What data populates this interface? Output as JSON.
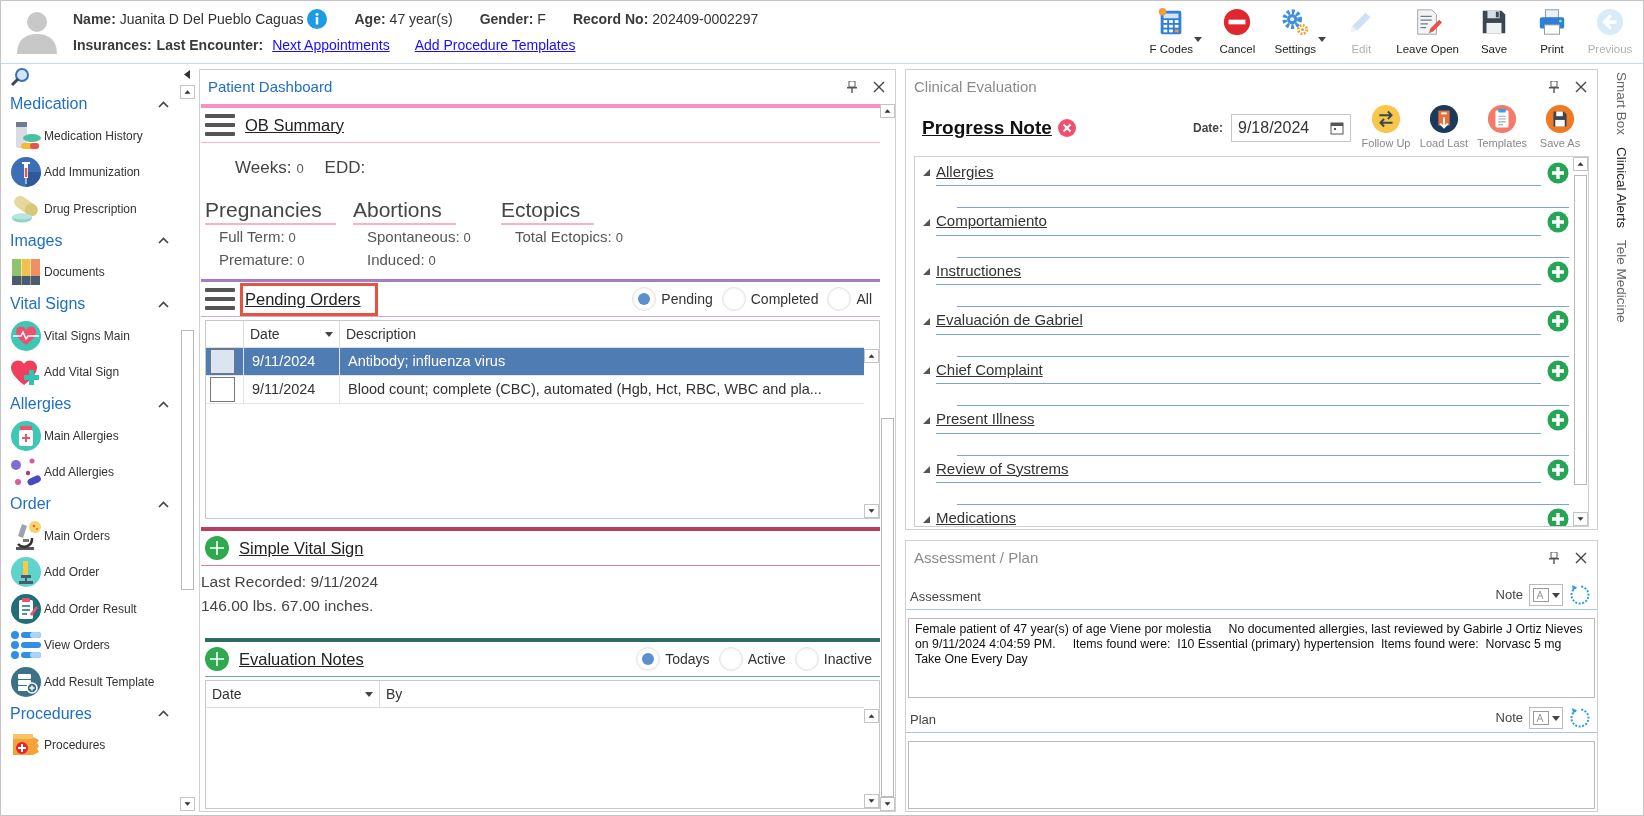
{
  "patient": {
    "fields": [
      {
        "label": "Name:",
        "value": "Juanita D Del Pueblo Caguas",
        "info": true
      },
      {
        "label": "Age:",
        "value": "47 year(s)"
      },
      {
        "label": "Gender:",
        "value": "F"
      },
      {
        "label": "Record No:",
        "value": "202409-0002297"
      }
    ],
    "second_line": {
      "labels": [
        "Insurances:",
        "Last Encounter:"
      ],
      "links": [
        "Next Appointments",
        "Add Procedure Templates"
      ]
    }
  },
  "toolbar": [
    {
      "label": "F Codes",
      "kind": "fcodes",
      "dropdown": true,
      "disabled": false
    },
    {
      "label": "Cancel",
      "kind": "cancel",
      "dropdown": false,
      "disabled": false
    },
    {
      "label": "Settings",
      "kind": "settings",
      "dropdown": true,
      "disabled": false
    },
    {
      "label": "Edit",
      "kind": "edit",
      "dropdown": false,
      "disabled": true
    },
    {
      "label": "Leave Open",
      "kind": "leave_open",
      "dropdown": false,
      "disabled": false
    },
    {
      "label": "Save",
      "kind": "save",
      "dropdown": false,
      "disabled": false
    },
    {
      "label": "Print",
      "kind": "print",
      "dropdown": false,
      "disabled": false
    },
    {
      "label": "Previous",
      "kind": "previous",
      "dropdown": false,
      "disabled": true
    }
  ],
  "sidebar": {
    "sections": [
      {
        "title": "Medication",
        "expanded": true,
        "items": [
          {
            "label": "Medication History",
            "kind": "pill_bottle"
          },
          {
            "label": "Add Immunization",
            "kind": "syringe"
          },
          {
            "label": "Drug Prescription",
            "kind": "capsule"
          }
        ]
      },
      {
        "title": "Images",
        "expanded": true,
        "items": [
          {
            "label": "Documents",
            "kind": "binders"
          }
        ]
      },
      {
        "title": "Vital Signs",
        "expanded": true,
        "items": [
          {
            "label": "Vital Signs Main",
            "kind": "heart_monitor"
          },
          {
            "label": "Add Vital Sign",
            "kind": "heart_plus"
          }
        ]
      },
      {
        "title": "Allergies",
        "expanded": true,
        "items": [
          {
            "label": "Main Allergies",
            "kind": "bottle"
          },
          {
            "label": "Add Allergies",
            "kind": "tablets"
          }
        ]
      },
      {
        "title": "Order",
        "expanded": true,
        "items": [
          {
            "label": "Main Orders",
            "kind": "microscope"
          },
          {
            "label": "Add Order",
            "kind": "microscope_badge"
          },
          {
            "label": "Add Order Result",
            "kind": "clipboard"
          },
          {
            "label": "View Orders",
            "kind": "list"
          },
          {
            "label": "Add Result Template",
            "kind": "server_plus"
          }
        ]
      },
      {
        "title": "Procedures",
        "expanded": true,
        "items": [
          {
            "label": "Procedures",
            "kind": "kit"
          }
        ]
      }
    ]
  },
  "dashboard": {
    "title": "Patient Dashboard",
    "ob_summary": {
      "title": "OB Summary",
      "weeks_label": "Weeks:",
      "weeks": "0",
      "edd_label": "EDD:",
      "groups": [
        {
          "title": "Pregnancies",
          "lines": [
            {
              "label": "Full Term:",
              "value": "0"
            },
            {
              "label": "Premature:",
              "value": "0"
            }
          ]
        },
        {
          "title": "Abortions",
          "lines": [
            {
              "label": "Spontaneous:",
              "value": "0"
            },
            {
              "label": "Induced:",
              "value": "0"
            }
          ]
        },
        {
          "title": "Ectopics",
          "lines": [
            {
              "label": "Total Ectopics:",
              "value": "0"
            }
          ]
        }
      ]
    },
    "pending_orders": {
      "title": "Pending Orders",
      "highlighted": true,
      "filters": [
        {
          "label": "Pending",
          "selected": true
        },
        {
          "label": "Completed",
          "selected": false
        },
        {
          "label": "All",
          "selected": false
        }
      ],
      "columns": [
        {
          "label": "Date",
          "sorted": true
        },
        {
          "label": "Description",
          "sorted": false
        }
      ],
      "rows": [
        {
          "date": "9/11/2024",
          "description": "Antibody; influenza virus",
          "selected": true
        },
        {
          "date": "9/11/2024",
          "description": "Blood count; complete (CBC), automated (Hgb, Hct, RBC, WBC and pla...",
          "selected": false
        }
      ]
    },
    "vital_sign": {
      "title": "Simple Vital Sign",
      "lines": [
        "Last Recorded: 9/11/2024",
        "146.00 lbs. 67.00 inches."
      ]
    },
    "evaluation_notes": {
      "title": "Evaluation Notes",
      "filters": [
        {
          "label": "Todays",
          "selected": true
        },
        {
          "label": "Active",
          "selected": false
        },
        {
          "label": "Inactive",
          "selected": false
        }
      ],
      "columns": [
        {
          "label": "Date",
          "sorted": true
        },
        {
          "label": "By",
          "sorted": false
        }
      ]
    }
  },
  "clinical_evaluation": {
    "title": "Clinical Evaluation",
    "note_title": "Progress Note",
    "date_label": "Date:",
    "date": "9/18/2024",
    "actions": [
      {
        "label": "Follow Up",
        "kind": "follow_up"
      },
      {
        "label": "Load Last",
        "kind": "load_last"
      },
      {
        "label": "Templates",
        "kind": "templates"
      },
      {
        "label": "Save As",
        "kind": "save_as"
      }
    ],
    "sections": [
      {
        "title": "Allergies",
        "expanded": true
      },
      {
        "title": "Comportamiento",
        "expanded": true
      },
      {
        "title": "Instructiones",
        "expanded": true
      },
      {
        "title": "Evaluación de Gabriel",
        "expanded": true
      },
      {
        "title": "Chief Complaint",
        "expanded": true
      },
      {
        "title": "Present Illness",
        "expanded": true
      },
      {
        "title": "Review of Systrems",
        "expanded": true
      },
      {
        "title": "Medications",
        "expanded": true
      }
    ]
  },
  "assessment_plan": {
    "title": "Assessment / Plan",
    "fields": [
      {
        "label": "Assessment",
        "note_label": "Note",
        "value": "Female patient of 47 year(s) of age Viene por molestia     No documented allergies, last reviewed by Gabirle J Ortiz Nieves on 9/11/2024 4:04:59 PM.     Items found were:  I10 Essential (primary) hypertension  Items found were:  Norvasc 5 mg Take One Every Day"
      },
      {
        "label": "Plan",
        "note_label": "Note"
      }
    ]
  },
  "side_tabs": [
    {
      "label": "Smart Box",
      "selected": false
    },
    {
      "label": "Clinical Alerts",
      "selected": true
    },
    {
      "label": "Tele Medicine",
      "selected": false
    }
  ]
}
